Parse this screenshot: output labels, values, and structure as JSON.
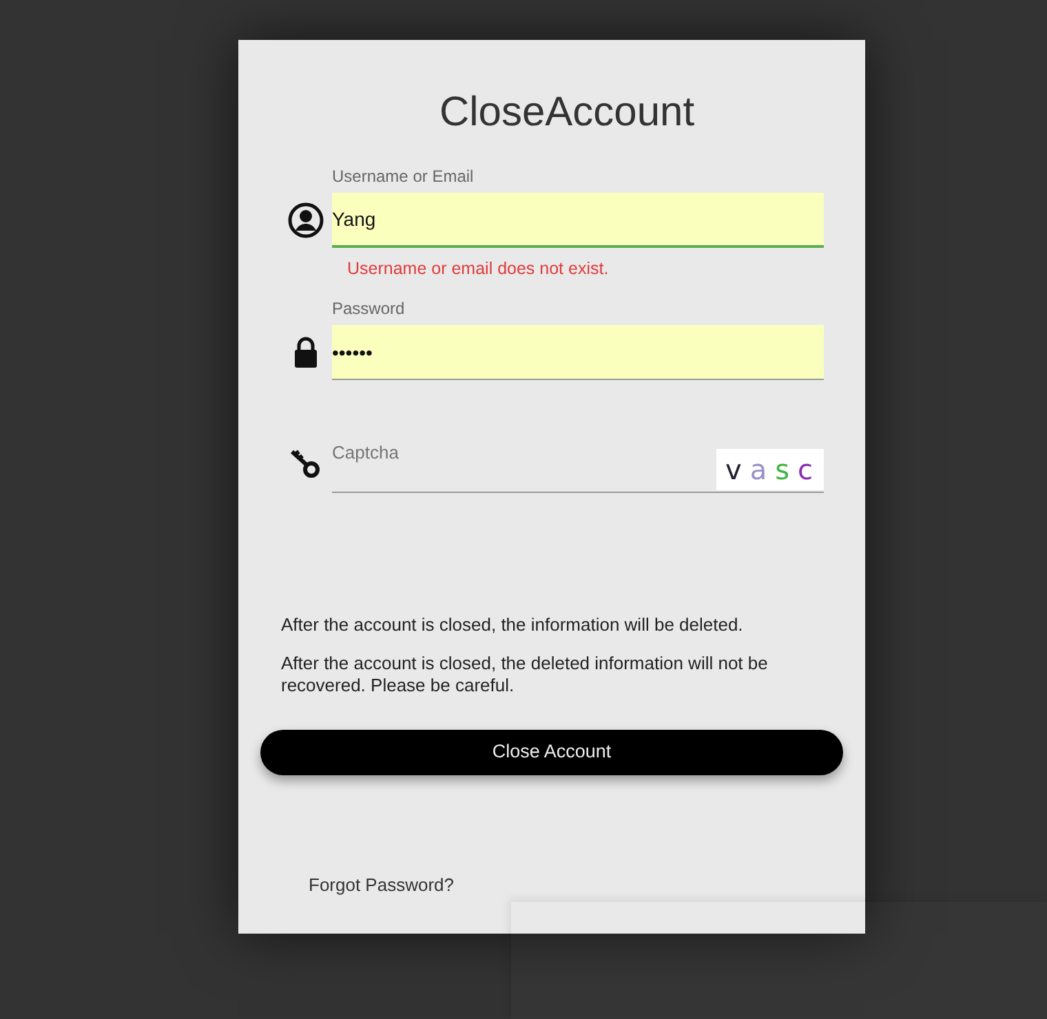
{
  "title": "CloseAccount",
  "fields": [
    {
      "kind": "text",
      "label": "Username or Email",
      "value": "Yang",
      "focused": true,
      "autofilled": true,
      "error": "Username or email does not exist."
    },
    {
      "kind": "password",
      "label": "Password",
      "value": "••••••",
      "focused": false,
      "autofilled": true
    },
    {
      "kind": "captcha",
      "placeholder": "Captcha",
      "focused": false,
      "autofilled": false,
      "captcha_text": "vasc"
    }
  ],
  "notes": [
    "After the account is closed, the information will be deleted.",
    "After the account is closed, the deleted information will not be recovered. Please be careful."
  ],
  "button": "Close Account",
  "link": "Forgot Password?"
}
